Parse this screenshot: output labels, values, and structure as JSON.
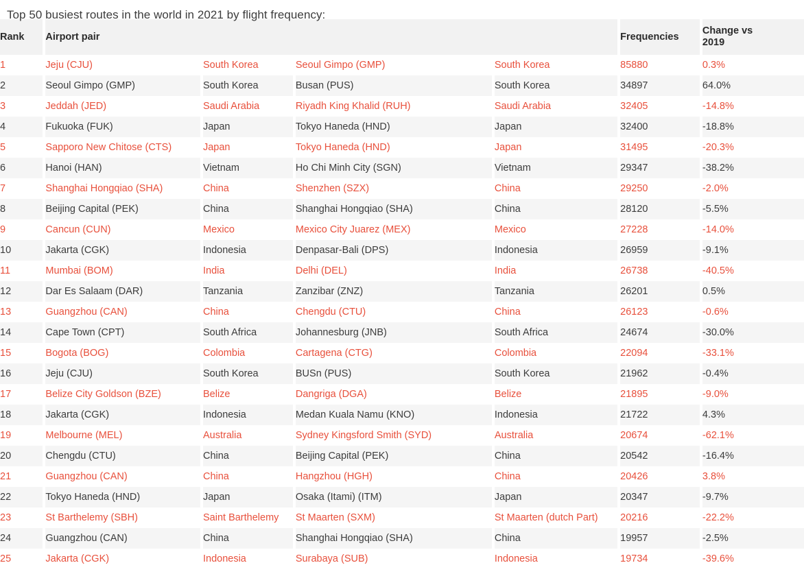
{
  "page": {
    "title": "Top 50 busiest routes in the world in 2021 by flight frequency:",
    "accent_color_red": "#e8503c",
    "text_color": "#3c3c3c",
    "header_bg": "#f2f2f2",
    "even_row_bg": "#f5f5f5",
    "odd_row_bg": "#ffffff"
  },
  "table": {
    "headers": {
      "rank": "Rank",
      "airport_pair": "Airport pair",
      "frequencies": "Frequencies",
      "change": "Change vs\n2019",
      "change_line1": "Change vs",
      "change_line2": "2019"
    },
    "columns": [
      "Rank",
      "Airport pair",
      "Frequencies",
      "Change vs 2019"
    ],
    "rows": [
      {
        "rank": "1",
        "airport_a": "Jeju (CJU)",
        "country_a": "South Korea",
        "airport_b": "Seoul Gimpo (GMP)",
        "country_b": "South Korea",
        "frequencies": "85880",
        "change": "0.3%"
      },
      {
        "rank": "2",
        "airport_a": "Seoul Gimpo (GMP)",
        "country_a": "South Korea",
        "airport_b": "Busan (PUS)",
        "country_b": "South Korea",
        "frequencies": "34897",
        "change": "64.0%"
      },
      {
        "rank": "3",
        "airport_a": "Jeddah (JED)",
        "country_a": "Saudi Arabia",
        "airport_b": "Riyadh King Khalid (RUH)",
        "country_b": "Saudi Arabia",
        "frequencies": "32405",
        "change": "-14.8%"
      },
      {
        "rank": "4",
        "airport_a": "Fukuoka (FUK)",
        "country_a": "Japan",
        "airport_b": "Tokyo Haneda (HND)",
        "country_b": "Japan",
        "frequencies": "32400",
        "change": "-18.8%"
      },
      {
        "rank": "5",
        "airport_a": "Sapporo New Chitose (CTS)",
        "country_a": "Japan",
        "airport_b": "Tokyo Haneda (HND)",
        "country_b": "Japan",
        "frequencies": "31495",
        "change": "-20.3%"
      },
      {
        "rank": "6",
        "airport_a": "Hanoi (HAN)",
        "country_a": "Vietnam",
        "airport_b": "Ho Chi Minh City (SGN)",
        "country_b": "Vietnam",
        "frequencies": "29347",
        "change": "-38.2%"
      },
      {
        "rank": "7",
        "airport_a": "Shanghai Hongqiao (SHA)",
        "country_a": "China",
        "airport_b": "Shenzhen (SZX)",
        "country_b": "China",
        "frequencies": "29250",
        "change": "-2.0%"
      },
      {
        "rank": "8",
        "airport_a": "Beijing Capital (PEK)",
        "country_a": "China",
        "airport_b": "Shanghai Hongqiao (SHA)",
        "country_b": "China",
        "frequencies": "28120",
        "change": "-5.5%"
      },
      {
        "rank": "9",
        "airport_a": "Cancun (CUN)",
        "country_a": "Mexico",
        "airport_b": "Mexico City Juarez (MEX)",
        "country_b": "Mexico",
        "frequencies": "27228",
        "change": "-14.0%"
      },
      {
        "rank": "10",
        "airport_a": "Jakarta (CGK)",
        "country_a": "Indonesia",
        "airport_b": "Denpasar-Bali (DPS)",
        "country_b": "Indonesia",
        "frequencies": "26959",
        "change": "-9.1%"
      },
      {
        "rank": "11",
        "airport_a": "Mumbai (BOM)",
        "country_a": "India",
        "airport_b": "Delhi (DEL)",
        "country_b": "India",
        "frequencies": "26738",
        "change": "-40.5%"
      },
      {
        "rank": "12",
        "airport_a": "Dar Es Salaam (DAR)",
        "country_a": "Tanzania",
        "airport_b": "Zanzibar (ZNZ)",
        "country_b": "Tanzania",
        "frequencies": "26201",
        "change": "0.5%"
      },
      {
        "rank": "13",
        "airport_a": "Guangzhou (CAN)",
        "country_a": "China",
        "airport_b": "Chengdu (CTU)",
        "country_b": "China",
        "frequencies": "26123",
        "change": "-0.6%"
      },
      {
        "rank": "14",
        "airport_a": "Cape Town (CPT)",
        "country_a": "South Africa",
        "airport_b": "Johannesburg (JNB)",
        "country_b": "South Africa",
        "frequencies": "24674",
        "change": "-30.0%"
      },
      {
        "rank": "15",
        "airport_a": "Bogota (BOG)",
        "country_a": "Colombia",
        "airport_b": "Cartagena (CTG)",
        "country_b": "Colombia",
        "frequencies": "22094",
        "change": "-33.1%"
      },
      {
        "rank": "16",
        "airport_a": "Jeju (CJU)",
        "country_a": "South Korea",
        "airport_b": "BUSn (PUS)",
        "country_b": "South Korea",
        "frequencies": "21962",
        "change": "-0.4%"
      },
      {
        "rank": "17",
        "airport_a": "Belize City Goldson (BZE)",
        "country_a": "Belize",
        "airport_b": "Dangriga (DGA)",
        "country_b": "Belize",
        "frequencies": "21895",
        "change": "-9.0%"
      },
      {
        "rank": "18",
        "airport_a": "Jakarta (CGK)",
        "country_a": "Indonesia",
        "airport_b": "Medan Kuala Namu (KNO)",
        "country_b": "Indonesia",
        "frequencies": "21722",
        "change": "4.3%"
      },
      {
        "rank": "19",
        "airport_a": "Melbourne (MEL)",
        "country_a": "Australia",
        "airport_b": "Sydney Kingsford Smith (SYD)",
        "country_b": "Australia",
        "frequencies": "20674",
        "change": "-62.1%"
      },
      {
        "rank": "20",
        "airport_a": "Chengdu (CTU)",
        "country_a": "China",
        "airport_b": "Beijing Capital (PEK)",
        "country_b": "China",
        "frequencies": "20542",
        "change": "-16.4%"
      },
      {
        "rank": "21",
        "airport_a": "Guangzhou (CAN)",
        "country_a": "China",
        "airport_b": "Hangzhou (HGH)",
        "country_b": "China",
        "frequencies": "20426",
        "change": "3.8%"
      },
      {
        "rank": "22",
        "airport_a": "Tokyo Haneda (HND)",
        "country_a": "Japan",
        "airport_b": "Osaka (Itami) (ITM)",
        "country_b": "Japan",
        "frequencies": "20347",
        "change": "-9.7%"
      },
      {
        "rank": "23",
        "airport_a": "St Barthelemy (SBH)",
        "country_a": "Saint Barthelemy",
        "airport_b": "St Maarten (SXM)",
        "country_b": "St Maarten (dutch Part)",
        "frequencies": "20216",
        "change": "-22.2%"
      },
      {
        "rank": "24",
        "airport_a": "Guangzhou (CAN)",
        "country_a": "China",
        "airport_b": "Shanghai Hongqiao (SHA)",
        "country_b": "China",
        "frequencies": "19957",
        "change": "-2.5%"
      },
      {
        "rank": "25",
        "airport_a": "Jakarta (CGK)",
        "country_a": "Indonesia",
        "airport_b": "Surabaya (SUB)",
        "country_b": "Indonesia",
        "frequencies": "19734",
        "change": "-39.6%"
      }
    ]
  }
}
